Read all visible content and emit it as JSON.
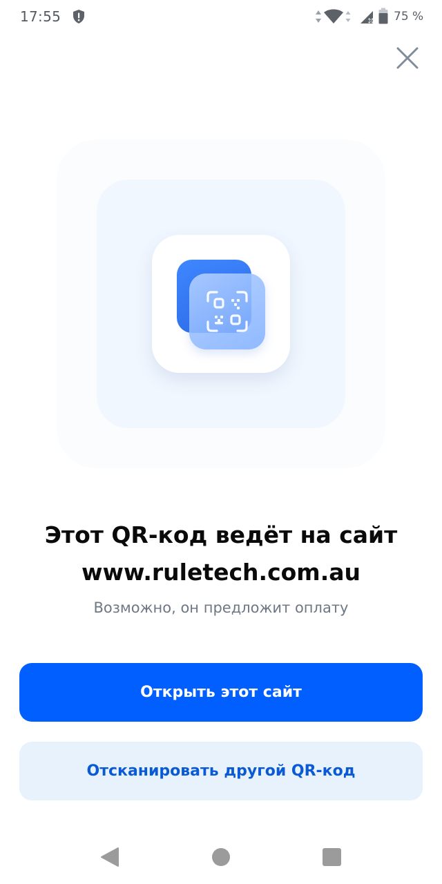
{
  "status_bar": {
    "time": "17:55",
    "battery": "75 %",
    "icons": [
      "shield-alert-icon",
      "data-arrows-icon",
      "wifi-icon",
      "signal-icon",
      "battery-icon"
    ]
  },
  "dialog": {
    "close_icon": "close-icon",
    "illustration_icon": "qr-scan-icon",
    "title_line1": "Этот QR-код ведёт на сайт",
    "title_line2": "www.ruletech.com.au",
    "subtitle": "Возможно, он предложит оплату",
    "primary_button": "Открыть этот сайт",
    "secondary_button": "Отсканировать другой QR-код"
  },
  "nav_bar": {
    "icons": [
      "back-icon",
      "home-icon",
      "recents-icon"
    ]
  },
  "colors": {
    "primary": "#005ffe",
    "secondary_bg": "#e7f2fd",
    "secondary_text": "#0a5ad6",
    "title": "#0a0a0a",
    "subtitle": "#6d7884"
  }
}
